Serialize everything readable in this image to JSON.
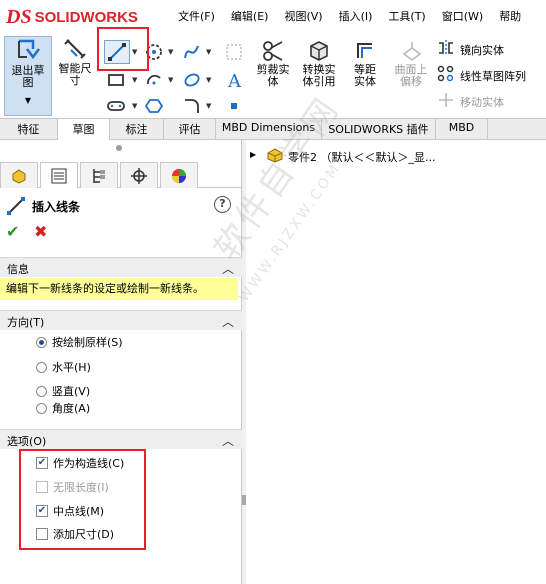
{
  "app": {
    "logo_ds": "DS",
    "logo_text": "SOLIDWORKS",
    "brand_color": "#d8232a"
  },
  "menu": [
    "文件(F)",
    "编辑(E)",
    "视图(V)",
    "插入(I)",
    "工具(T)",
    "窗口(W)",
    "帮助"
  ],
  "ribbon": {
    "exit_sketch": "退出草图",
    "smart_dim": "智能尺寸",
    "trim": "剪裁实体",
    "convert": "转换实体引用",
    "offset": "等距实体",
    "offset_surface": "曲面上偏移",
    "mirror": "镜向实体",
    "linear_pattern": "线性草图阵列",
    "move": "移动实体"
  },
  "tabs": [
    "特征",
    "草图",
    "标注",
    "评估",
    "MBD Dimensions",
    "SOLIDWORKS 插件",
    "MBD"
  ],
  "active_tab": "草图",
  "panel": {
    "title": "插入线条",
    "info_header": "信息",
    "info_text": "编辑下一新线条的设定或绘制一新线条。",
    "direction_header": "方向(T)",
    "direction_options": [
      {
        "label": "按绘制原样(S)",
        "checked": true
      },
      {
        "label": "水平(H)",
        "checked": false
      },
      {
        "label": "竖直(V)",
        "checked": false
      },
      {
        "label": "角度(A)",
        "checked": false
      }
    ],
    "options_header": "选项(O)",
    "options": [
      {
        "label": "作为构造线(C)",
        "checked": true,
        "enabled": true
      },
      {
        "label": "无限长度(I)",
        "checked": false,
        "enabled": false
      },
      {
        "label": "中点线(M)",
        "checked": true,
        "enabled": true
      },
      {
        "label": "添加尺寸(D)",
        "checked": false,
        "enabled": true
      }
    ]
  },
  "tree": {
    "root_label": "零件2 （默认＜＜默认＞_显..."
  },
  "watermark": {
    "line1": "软件自学网",
    "line2": "WWW.RJZXW.COM"
  },
  "colors": {
    "highlight_yellow": "#ffff99",
    "annotation_red": "#e8202a",
    "accent_blue": "#1f6fc8"
  }
}
